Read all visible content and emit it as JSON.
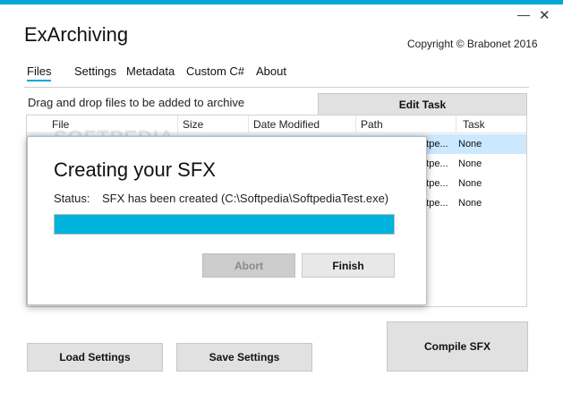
{
  "window": {
    "title": "ExArchiving",
    "copyright": "Copyright © Brabonet 2016",
    "minimize_glyph": "—",
    "close_glyph": "✕",
    "accent_color": "#00a8d8"
  },
  "tabs": [
    "Files",
    "Settings",
    "Metadata",
    "Custom C#",
    "About"
  ],
  "active_tab": "Files",
  "files": {
    "drag_hint": "Drag and drop files to be added to archive",
    "edit_task_label": "Edit Task",
    "columns": [
      "File",
      "Size",
      "Date Modified",
      "Path",
      "Task"
    ],
    "rows": [
      {
        "path": "oftpe...",
        "task": "None",
        "selected": true
      },
      {
        "path": "oftpe...",
        "task": "None",
        "selected": false
      },
      {
        "path": "oftpe...",
        "task": "None",
        "selected": false
      },
      {
        "path": "oftpe...",
        "task": "None",
        "selected": false
      }
    ]
  },
  "watermark": "SOFTPEDIA",
  "dialog": {
    "title": "Creating your SFX",
    "status_label": "Status:",
    "status_text": "SFX has been created (C:\\Softpedia\\SoftpediaTest.exe)",
    "progress": 1.0,
    "abort_label": "Abort",
    "finish_label": "Finish"
  },
  "footer": {
    "load_settings_label": "Load Settings",
    "save_settings_label": "Save Settings",
    "compile_label": "Compile SFX"
  }
}
